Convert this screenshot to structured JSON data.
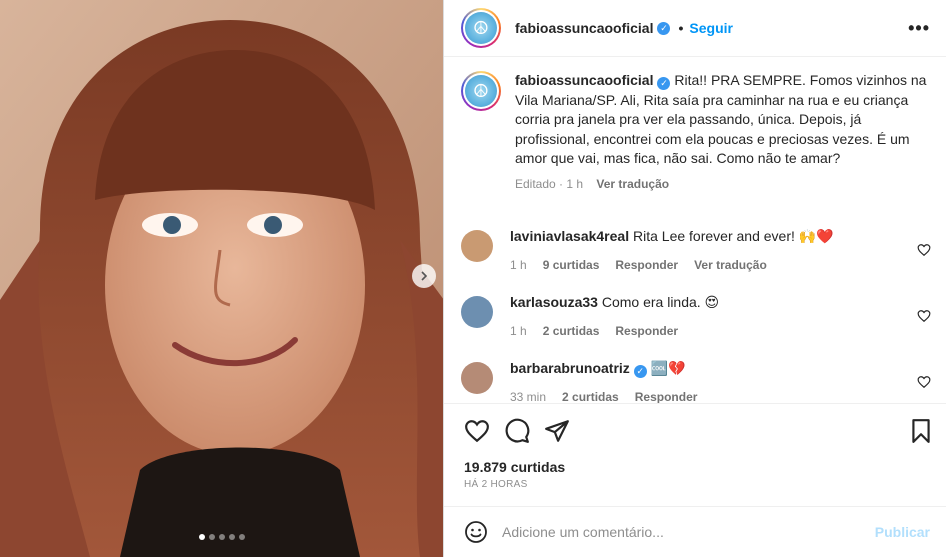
{
  "header": {
    "username": "fabioassuncaooficial",
    "separator": "•",
    "follow_label": "Seguir",
    "more_label": "•••"
  },
  "caption": {
    "username": "fabioassuncaooficial",
    "text": "Rita!! PRA SEMPRE. Fomos vizinhos na Vila Mariana/SP. Ali, Rita saía pra caminhar na rua e eu criança corria pra janela pra ver ela passando, única. Depois, já profissional, encontrei com ela poucas e preciosas vezes. É um amor que vai, mas fica, não sai. Como não te amar?",
    "edited": "Editado · 1 h",
    "translate": "Ver tradução"
  },
  "comments": [
    {
      "username": "laviniavlasak4real",
      "text": "Rita Lee forever and ever! 🙌❤️",
      "time": "1 h",
      "likes": "9 curtidas",
      "reply": "Responder",
      "translate": "Ver tradução",
      "avatar_color": "#c99a72"
    },
    {
      "username": "karlasouza33",
      "text": "Como era linda. 😍",
      "time": "1 h",
      "likes": "2 curtidas",
      "reply": "Responder",
      "avatar_color": "#6d8fb0"
    },
    {
      "username": "barbarabrunoatriz",
      "text": "🆒💔",
      "time": "33 min",
      "likes": "2 curtidas",
      "reply": "Responder",
      "avatar_color": "#b58b76"
    }
  ],
  "stats": {
    "likes": "19.879 curtidas",
    "time": "HÁ 2 HORAS"
  },
  "add_comment": {
    "placeholder": "Adicione um comentário...",
    "publish_label": "Publicar"
  },
  "media": {
    "slides": 5,
    "active_slide": 1
  },
  "icons": [
    "verified-icon",
    "heart-icon",
    "comment-icon",
    "share-icon",
    "bookmark-icon",
    "emoji-icon",
    "chevron-right-icon"
  ],
  "colors": {
    "accent": "#0095f6",
    "verified": "#3897f0",
    "publish_disabled": "#b2dffc",
    "meta": "#8e8e8e"
  }
}
